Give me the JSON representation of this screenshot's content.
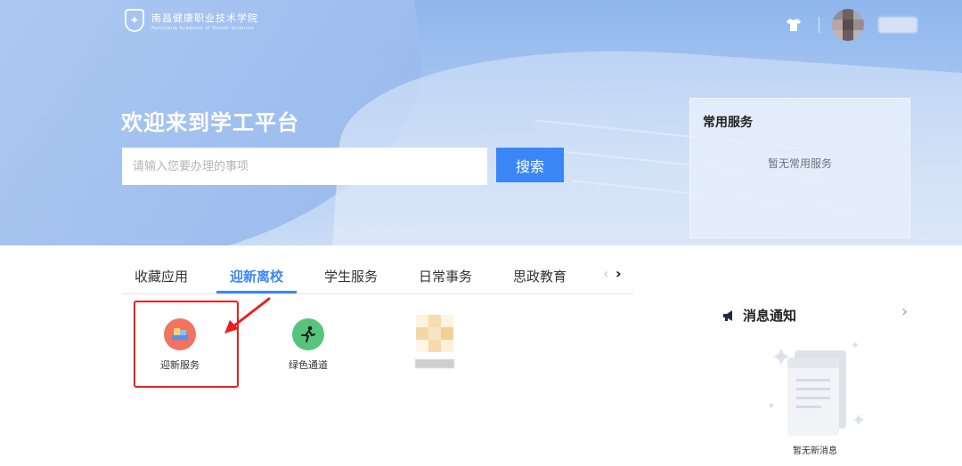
{
  "header": {
    "logo_cn": "南昌健康职业技术学院",
    "logo_en": "Nanchang Academy of Health Sciences"
  },
  "hero": {
    "welcome": "欢迎来到学工平台",
    "search_placeholder": "请输入您要办理的事项",
    "search_button": "搜索"
  },
  "common_services": {
    "title": "常用服务",
    "empty_text": "暂无常用服务"
  },
  "tabs": [
    {
      "label": "收藏应用",
      "active": false
    },
    {
      "label": "迎新离校",
      "active": true
    },
    {
      "label": "学生服务",
      "active": false
    },
    {
      "label": "日常事务",
      "active": false
    },
    {
      "label": "思政教育",
      "active": false
    }
  ],
  "tab_nav": {
    "prev": "‹",
    "next": "›"
  },
  "apps": [
    {
      "label": "迎新服务",
      "icon": "welcome-service-icon",
      "color": "#f2735f"
    },
    {
      "label": "绿色通道",
      "icon": "green-channel-icon",
      "color": "#56c47a"
    }
  ],
  "notices": {
    "title": "消息通知",
    "more": "›",
    "empty_text": "暂无新消息"
  },
  "colors": {
    "accent": "#3b86f7",
    "highlight": "#e8201e"
  }
}
